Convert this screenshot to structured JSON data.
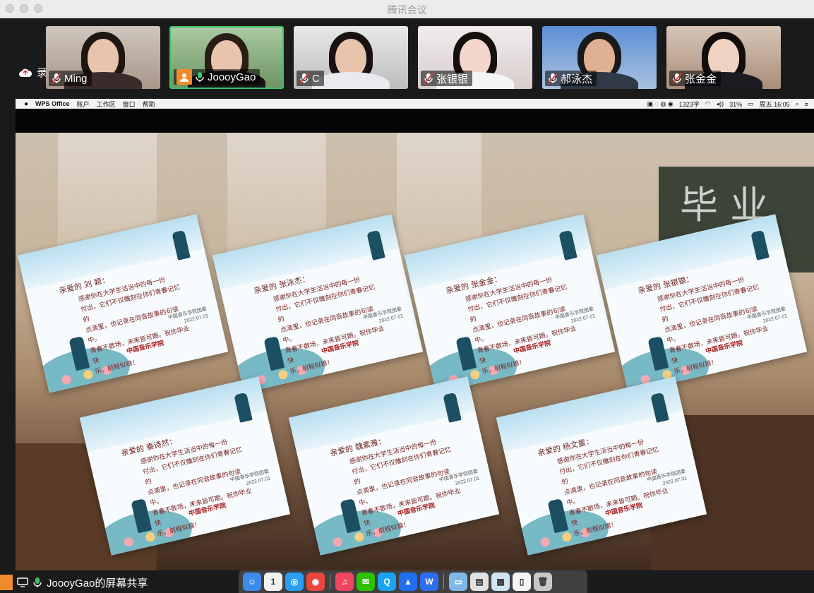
{
  "window": {
    "title": "腾讯会议"
  },
  "recording": {
    "label": "录制中",
    "icon": "cloud-icon"
  },
  "participants": [
    {
      "name": "Ming",
      "mic": "muted",
      "active": false
    },
    {
      "name": "JoooyGao",
      "mic": "on",
      "active": true,
      "badge": "avatar-icon"
    },
    {
      "name": "C",
      "mic": "muted",
      "active": false
    },
    {
      "name": "张银银",
      "mic": "muted",
      "active": false
    },
    {
      "name": "郝泳杰",
      "mic": "muted",
      "active": false
    },
    {
      "name": "张金金",
      "mic": "muted",
      "active": false
    }
  ],
  "shared_screen": {
    "menubar": {
      "app": "WPS Office",
      "items": [
        "账户",
        "工作区",
        "窗口",
        "帮助"
      ],
      "status_text": "1323字",
      "battery": "31%",
      "clock": "周五 16:05"
    },
    "chalkboard_text": "毕 业",
    "certificates": [
      {
        "salute": "亲爱的 刘 颖：",
        "seal": "中国音乐学院"
      },
      {
        "salute": "亲爱的 张泳杰：",
        "seal": "中国音乐学院"
      },
      {
        "salute": "亲爱的 张金金：",
        "seal": "中国音乐学院"
      },
      {
        "salute": "亲爱的 张银银：",
        "seal": "中国音乐学院"
      },
      {
        "salute": "亲爱的 秦诗然：",
        "seal": "中国音乐学院"
      },
      {
        "salute": "亲爱的 魏素雅：",
        "seal": "中国音乐学院"
      },
      {
        "salute": "亲爱的 杨文童：",
        "seal": "中国音乐学院"
      }
    ],
    "certificate_body": [
      "感谢你在大学生活当中的每一份",
      "付出，它们不仅雕刻在你们青春记忆的",
      "点滴里，也记录在同音故事的句读中。",
      "青春不散场，未来皆可期。祝你毕业快",
      "乐，前程似锦！"
    ],
    "certificate_org": [
      "中国音乐学院团委",
      "2022.07.01"
    ]
  },
  "bottom": {
    "share_label": "JoooyGao的屏幕共享"
  },
  "dock": {
    "apps": [
      {
        "name": "finder-icon",
        "color": "#3d8ae8",
        "glyph": "☺"
      },
      {
        "name": "calendar-icon",
        "color": "#f2f2f2",
        "glyph": "1"
      },
      {
        "name": "safari-icon",
        "color": "#2a9df4",
        "glyph": "◎"
      },
      {
        "name": "chrome-icon",
        "color": "#e8453c",
        "glyph": "◉"
      },
      {
        "name": "music-icon",
        "color": "#f0455f",
        "glyph": "♫"
      },
      {
        "name": "wechat-icon",
        "color": "#2dc100",
        "glyph": "✉"
      },
      {
        "name": "qq-icon",
        "color": "#1aa3f0",
        "glyph": "Q"
      },
      {
        "name": "meeting-icon",
        "color": "#1f6fef",
        "glyph": "▲"
      },
      {
        "name": "wps-icon",
        "color": "#2f6df0",
        "glyph": "W"
      },
      {
        "name": "folder-icon",
        "color": "#7fb8e6",
        "glyph": "▭"
      },
      {
        "name": "presentation-icon",
        "color": "#e2e2e2",
        "glyph": "▤"
      },
      {
        "name": "preview-icon",
        "color": "#cfe6f2",
        "glyph": "▦"
      },
      {
        "name": "document-icon",
        "color": "#f5f5f5",
        "glyph": "▯"
      },
      {
        "name": "trash-icon",
        "color": "#c8c8c8",
        "glyph": "🗑"
      }
    ]
  }
}
